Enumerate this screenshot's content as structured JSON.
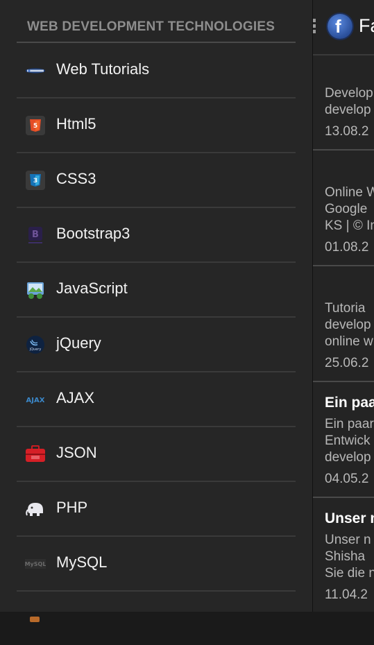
{
  "drawer": {
    "header": "WEB DEVELOPMENT TECHNOLOGIES",
    "items": [
      {
        "label": "Web Tutorials",
        "icon": "web-tutorials-logo-icon"
      },
      {
        "label": "Html5",
        "icon": "html5-icon"
      },
      {
        "label": "CSS3",
        "icon": "css3-icon"
      },
      {
        "label": "Bootstrap3",
        "icon": "bootstrap-icon"
      },
      {
        "label": "JavaScript",
        "icon": "javascript-icon"
      },
      {
        "label": "jQuery",
        "icon": "jquery-icon"
      },
      {
        "label": "AJAX",
        "icon": "ajax-icon"
      },
      {
        "label": "JSON",
        "icon": "json-toolbox-icon"
      },
      {
        "label": "PHP",
        "icon": "php-elephant-icon"
      },
      {
        "label": "MySQL",
        "icon": "mysql-icon"
      }
    ]
  },
  "content": {
    "title": "Fa",
    "posts": [
      {
        "lines": [
          "Develop",
          "develop"
        ],
        "date": "13.08.2"
      },
      {
        "lines": [
          "Online W",
          "Google",
          "KS | © In"
        ],
        "date": "01.08.2"
      },
      {
        "lines": [
          "Tutoria",
          "develop",
          "online w"
        ],
        "date": "25.06.2"
      },
      {
        "title": "Ein paa",
        "lines": [
          "Ein paar",
          "Entwick",
          "develop"
        ],
        "date": "04.05.2"
      },
      {
        "title": "Unser n",
        "lines": [
          "Unser n",
          "Shisha",
          "Sie die n"
        ],
        "date": "11.04.2"
      }
    ]
  },
  "colors": {
    "drawer_bg": "#262626",
    "divider": "#3a3a3a",
    "header_text": "#8d8d8d",
    "facebook_blue": "#3b5998"
  }
}
